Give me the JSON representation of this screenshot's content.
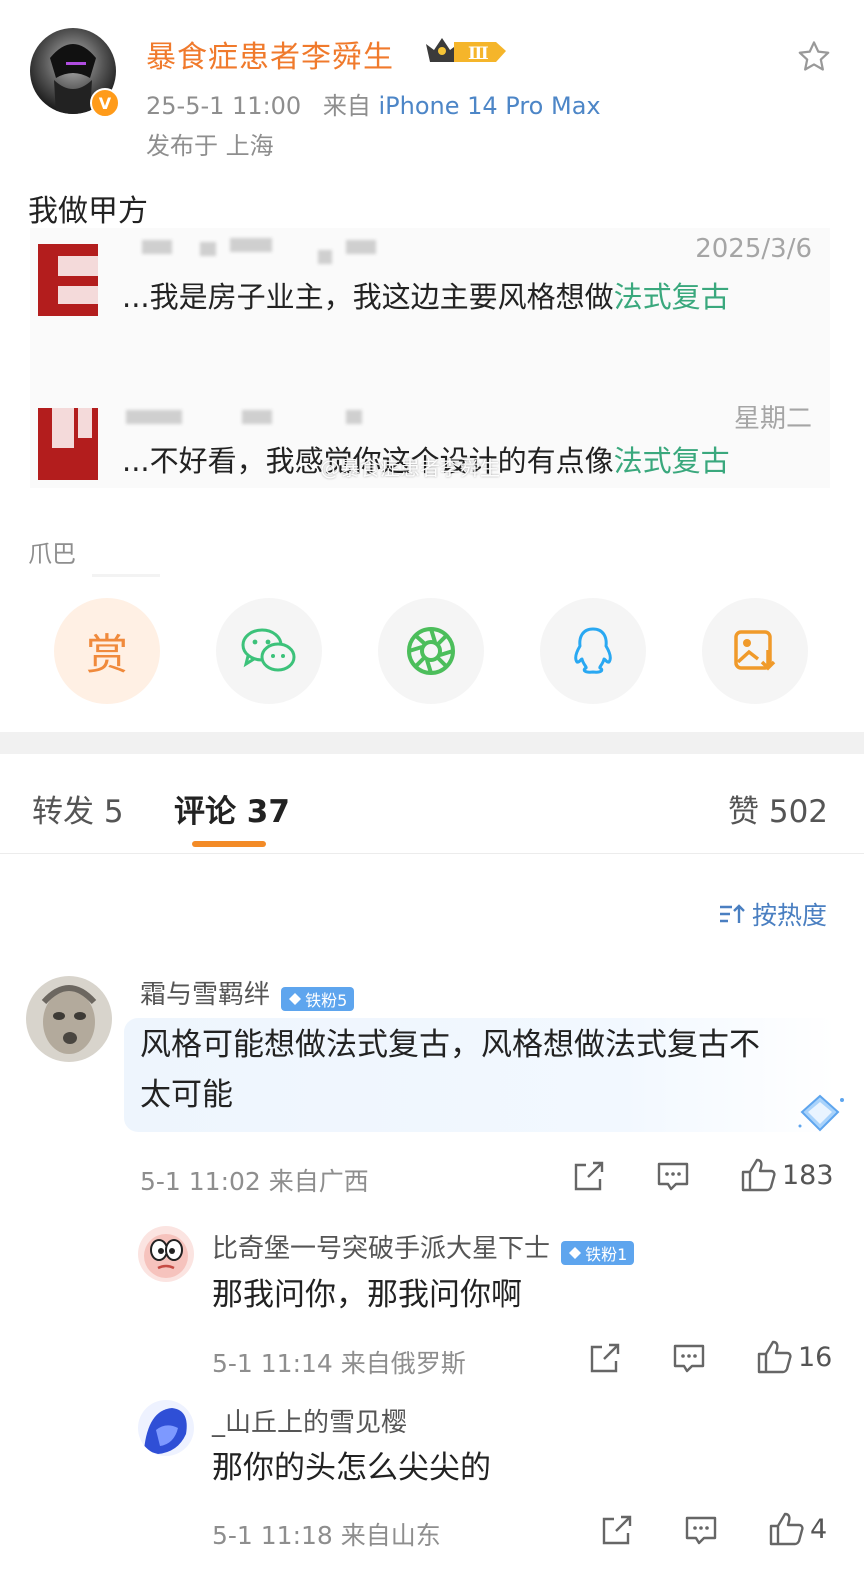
{
  "post": {
    "author": "暴食症患者李舜生",
    "level_badge": "Ⅲ",
    "time": "25-5-1 11:00",
    "from_label": "来自",
    "device": "iPhone 14 Pro Max",
    "location": "发布于 上海",
    "text": "我做甲方",
    "source": "爪巴"
  },
  "chat_image": {
    "messages": [
      {
        "date": "2025/3/6",
        "text": "...我是房子业主，我这边主要风格想做",
        "highlight": "法式复古"
      },
      {
        "date": "星期二",
        "text": "...不好看，我感觉你这个设计的有点像",
        "highlight": "法式复古"
      }
    ],
    "watermark": "@暴食症患者李舜生"
  },
  "share": {
    "reward_label": "赏",
    "icons": [
      "reward-icon",
      "wechat-icon",
      "moments-icon",
      "qq-icon",
      "save-image-icon"
    ]
  },
  "tabs": {
    "repost": "转发 5",
    "comments": "评论 37",
    "likes": "赞 502"
  },
  "sort_label": "按热度",
  "comments": [
    {
      "name": "霜与雪羁绊",
      "badge": "铁粉5",
      "text_line1": "风格可能想做法式复古，风格想做法式复古不",
      "text_line2": "太可能",
      "meta": "5-1 11:02  来自广西",
      "likes": "183"
    },
    {
      "name": "比奇堡一号突破手派大星下士",
      "badge": "铁粉1",
      "text": "那我问你，那我问你啊",
      "meta": "5-1 11:14  来自俄罗斯",
      "likes": "16"
    },
    {
      "name": "_山丘上的雪见樱",
      "text": "那你的头怎么尖尖的",
      "meta": "5-1 11:18  来自山东",
      "likes": "4"
    }
  ],
  "colors": {
    "author_orange": "#f07a2c",
    "link_blue": "#4d86c7",
    "highlight_green": "#3aa87d",
    "tab_underline": "#f38b27",
    "fan_badge": "#5ea5ee"
  }
}
